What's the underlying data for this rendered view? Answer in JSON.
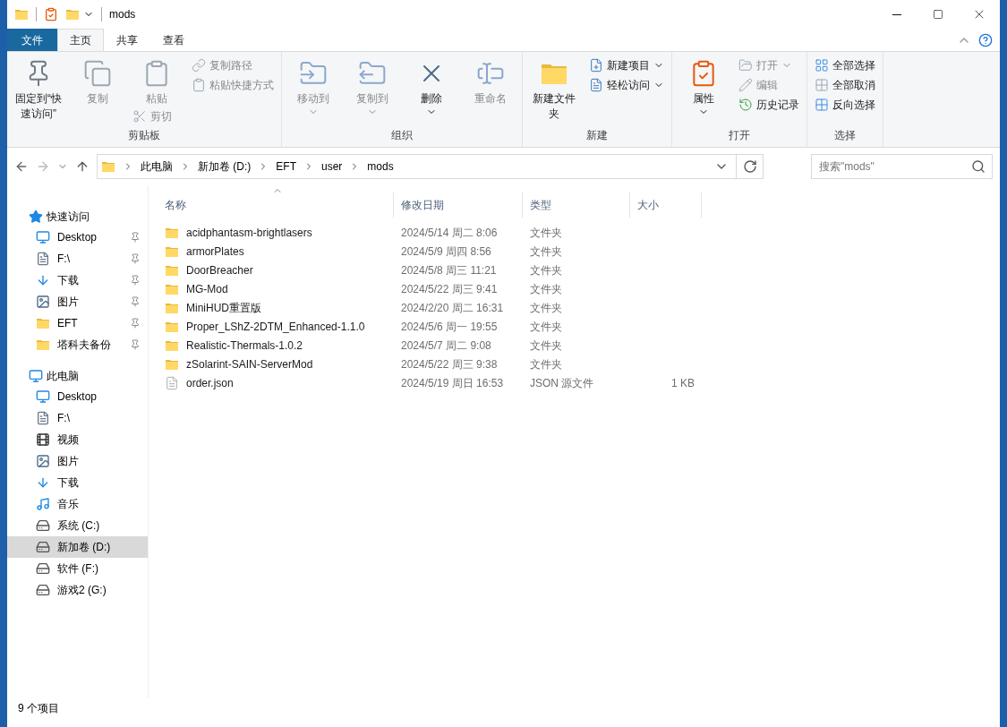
{
  "window": {
    "title": "mods"
  },
  "tabs": [
    {
      "label": "文件",
      "kind": "file",
      "selected": false
    },
    {
      "label": "主页",
      "kind": "tab",
      "selected": true
    },
    {
      "label": "共享",
      "kind": "tab",
      "selected": false
    },
    {
      "label": "查看",
      "kind": "tab",
      "selected": false
    }
  ],
  "ribbon": {
    "groups": [
      {
        "label": "剪贴板",
        "columns": [
          [
            {
              "label": "固定到“快速访问”",
              "kind": "large",
              "disabled": false,
              "menu": false
            }
          ],
          [
            {
              "label": "复制",
              "kind": "large",
              "disabled": true,
              "menu": false
            }
          ],
          [
            {
              "label": "粘贴",
              "kind": "large",
              "disabled": true,
              "menu": false
            },
            {
              "label": "剪切",
              "kind": "small",
              "disabled": true,
              "menu": false
            }
          ],
          [
            {
              "label": "复制路径",
              "kind": "small",
              "disabled": true,
              "menu": false
            },
            {
              "label": "粘贴快捷方式",
              "kind": "small",
              "disabled": true,
              "menu": false
            }
          ]
        ]
      },
      {
        "label": "组织",
        "columns": [
          [
            {
              "label": "移动到",
              "kind": "large",
              "disabled": true,
              "menu": true
            }
          ],
          [
            {
              "label": "复制到",
              "kind": "large",
              "disabled": true,
              "menu": true
            }
          ],
          [
            {
              "label": "删除",
              "kind": "large",
              "disabled": false,
              "menu": true
            }
          ],
          [
            {
              "label": "重命名",
              "kind": "large",
              "disabled": true,
              "menu": false
            }
          ]
        ]
      },
      {
        "label": "新建",
        "columns": [
          [
            {
              "label": "新建文件夹",
              "kind": "large",
              "disabled": false,
              "menu": false
            }
          ],
          [
            {
              "label": "新建项目",
              "kind": "small",
              "disabled": false,
              "menu": true
            },
            {
              "label": "轻松访问",
              "kind": "small",
              "disabled": false,
              "menu": true
            }
          ]
        ]
      },
      {
        "label": "打开",
        "columns": [
          [
            {
              "label": "属性",
              "kind": "large",
              "disabled": false,
              "menu": true
            }
          ],
          [
            {
              "label": "打开",
              "kind": "small",
              "disabled": true,
              "menu": true
            },
            {
              "label": "编辑",
              "kind": "small",
              "disabled": true,
              "menu": false
            },
            {
              "label": "历史记录",
              "kind": "small",
              "disabled": false,
              "menu": false
            }
          ]
        ]
      },
      {
        "label": "选择",
        "columns": [
          [
            {
              "label": "全部选择",
              "kind": "small",
              "disabled": false,
              "menu": false
            },
            {
              "label": "全部取消",
              "kind": "small",
              "disabled": false,
              "menu": false
            },
            {
              "label": "反向选择",
              "kind": "small",
              "disabled": false,
              "menu": false
            }
          ]
        ]
      }
    ]
  },
  "address": {
    "path": [
      "此电脑",
      "新加卷 (D:)",
      "EFT",
      "user",
      "mods"
    ]
  },
  "search": {
    "placeholder": "搜索\"mods\""
  },
  "sidebar": {
    "sections": [
      {
        "label": "快速访问",
        "kind": "quick",
        "items": [
          {
            "label": "Desktop",
            "kind": "desktop",
            "pinned": true,
            "selected": false
          },
          {
            "label": "F:\\",
            "kind": "doc",
            "pinned": true,
            "selected": false
          },
          {
            "label": "下载",
            "kind": "download",
            "pinned": true,
            "selected": false
          },
          {
            "label": "图片",
            "kind": "pictures",
            "pinned": true,
            "selected": false
          },
          {
            "label": "EFT",
            "kind": "folder",
            "pinned": true,
            "selected": false
          },
          {
            "label": "塔科夫备份",
            "kind": "folder",
            "pinned": true,
            "selected": false
          }
        ]
      },
      {
        "label": "此电脑",
        "kind": "pc",
        "items": [
          {
            "label": "Desktop",
            "kind": "desktop",
            "pinned": false,
            "selected": false
          },
          {
            "label": "F:\\",
            "kind": "doc",
            "pinned": false,
            "selected": false
          },
          {
            "label": "视频",
            "kind": "video",
            "pinned": false,
            "selected": false
          },
          {
            "label": "图片",
            "kind": "pictures",
            "pinned": false,
            "selected": false
          },
          {
            "label": "下载",
            "kind": "download",
            "pinned": false,
            "selected": false
          },
          {
            "label": "音乐",
            "kind": "music",
            "pinned": false,
            "selected": false
          },
          {
            "label": "系统 (C:)",
            "kind": "system-drive",
            "pinned": false,
            "selected": false
          },
          {
            "label": "新加卷 (D:)",
            "kind": "drive",
            "pinned": false,
            "selected": true
          },
          {
            "label": "软件 (F:)",
            "kind": "drive",
            "pinned": false,
            "selected": false
          },
          {
            "label": "游戏2 (G:)",
            "kind": "drive",
            "pinned": false,
            "selected": false
          }
        ]
      }
    ]
  },
  "table": {
    "columns": [
      "名称",
      "修改日期",
      "类型",
      "大小"
    ],
    "rows": [
      {
        "kind": "folder",
        "name": "acidphantasm-brightlasers",
        "date": "2024/5/14 周二 8:06",
        "type": "文件夹"
      },
      {
        "kind": "folder",
        "name": "armorPlates",
        "date": "2024/5/9 周四 8:56",
        "type": "文件夹"
      },
      {
        "kind": "folder",
        "name": "DoorBreacher",
        "date": "2024/5/8 周三 11:21",
        "type": "文件夹"
      },
      {
        "kind": "folder",
        "name": "MG-Mod",
        "date": "2024/5/22 周三 9:41",
        "type": "文件夹"
      },
      {
        "kind": "folder",
        "name": "MiniHUD重置版",
        "date": "2024/2/20 周二 16:31",
        "type": "文件夹"
      },
      {
        "kind": "folder",
        "name": "Proper_LShZ-2DTM_Enhanced-1.1.0",
        "date": "2024/5/6 周一 19:55",
        "type": "文件夹"
      },
      {
        "kind": "folder",
        "name": "Realistic-Thermals-1.0.2",
        "date": "2024/5/7 周二 9:08",
        "type": "文件夹"
      },
      {
        "kind": "folder",
        "name": "zSolarint-SAIN-ServerMod",
        "date": "2024/5/22 周三 9:38",
        "type": "文件夹"
      },
      {
        "kind": "json",
        "name": "order.json",
        "date": "2024/5/19 周日 16:53",
        "type": "JSON 源文件",
        "size": "1 KB"
      }
    ]
  },
  "status_bar": {
    "count": "9 个项目"
  }
}
